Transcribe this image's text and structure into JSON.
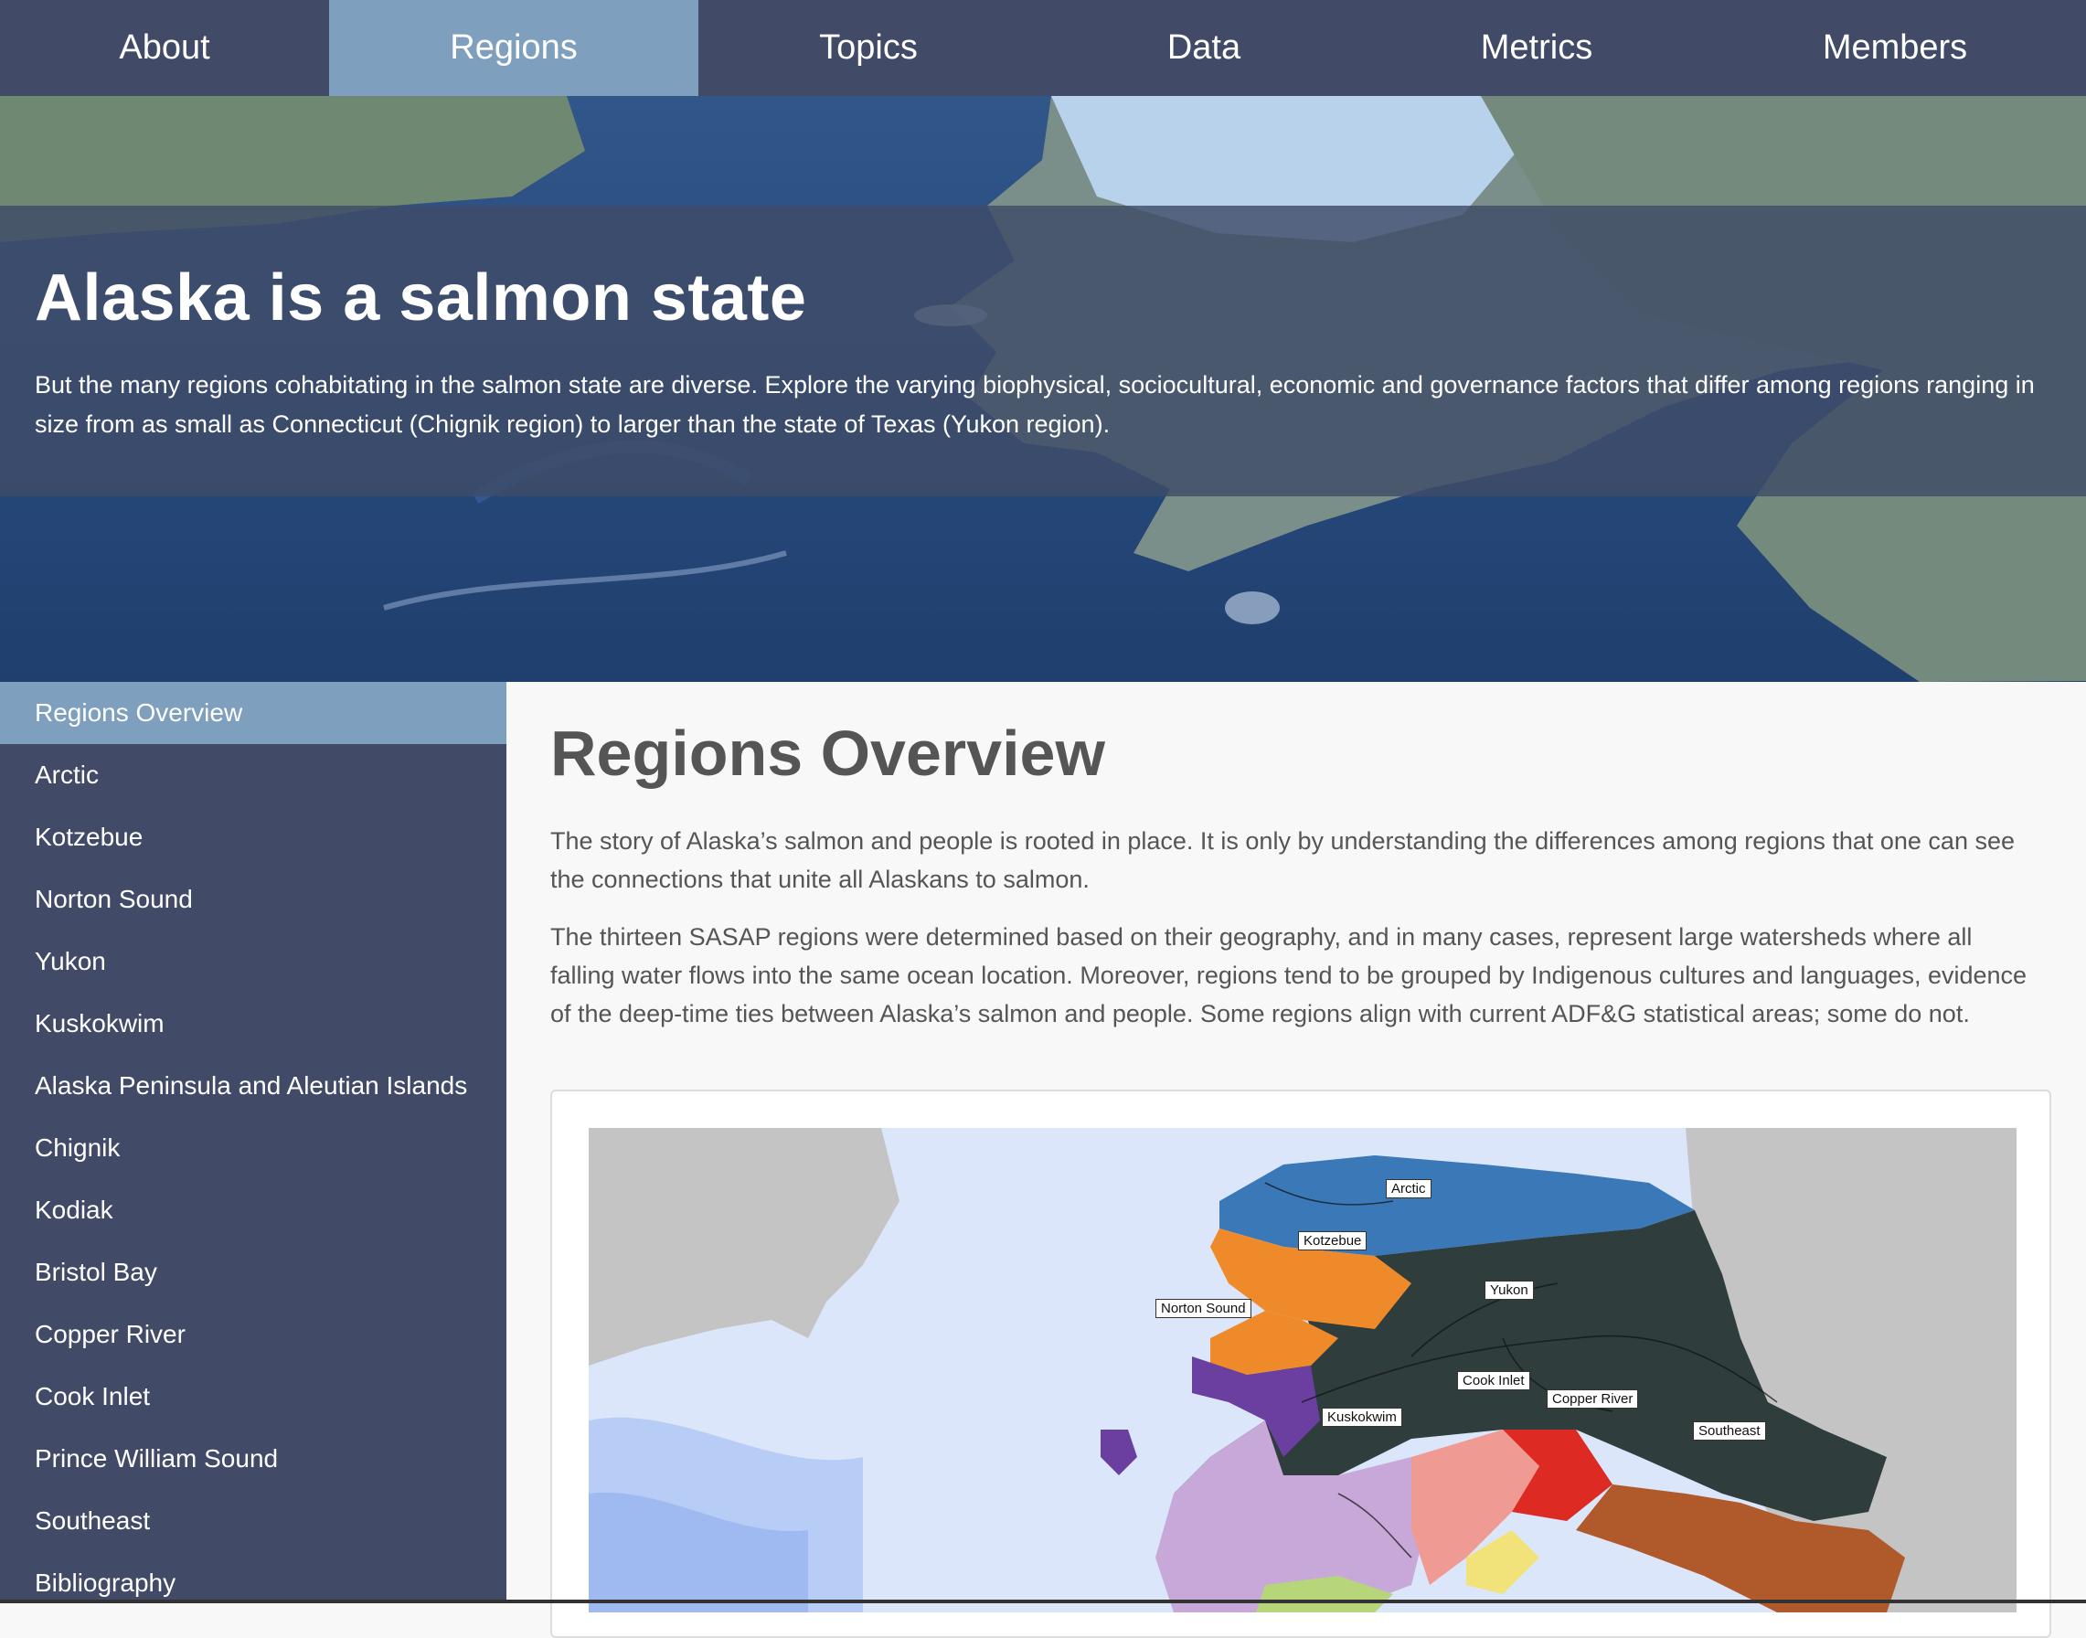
{
  "nav": {
    "tabs": [
      {
        "label": "About"
      },
      {
        "label": "Regions"
      },
      {
        "label": "Topics"
      },
      {
        "label": "Data"
      },
      {
        "label": "Metrics"
      },
      {
        "label": "Members"
      }
    ],
    "active_index": 1
  },
  "hero": {
    "title": "Alaska is a salmon state",
    "text": "But the many regions cohabitating in the salmon state are diverse. Explore the varying biophysical, sociocultural, economic and governance factors that differ among regions ranging in size from as small as Connecticut (Chignik region) to larger than the state of Texas (Yukon region)."
  },
  "sidebar": {
    "items": [
      {
        "label": "Regions Overview"
      },
      {
        "label": "Arctic"
      },
      {
        "label": "Kotzebue"
      },
      {
        "label": "Norton Sound"
      },
      {
        "label": "Yukon"
      },
      {
        "label": "Kuskokwim"
      },
      {
        "label": "Alaska Peninsula and Aleutian Islands"
      },
      {
        "label": "Chignik"
      },
      {
        "label": "Kodiak"
      },
      {
        "label": "Bristol Bay"
      },
      {
        "label": "Copper River"
      },
      {
        "label": "Cook Inlet"
      },
      {
        "label": "Prince William Sound"
      },
      {
        "label": "Southeast"
      },
      {
        "label": "Bibliography"
      }
    ],
    "active_index": 0
  },
  "main": {
    "title": "Regions Overview",
    "paragraphs": [
      "The story of Alaska’s salmon and people is rooted in place. It is only by understanding the differences among regions that one can see the connections that unite all Alaskans to salmon.",
      "The thirteen SASAP regions were determined based on their geography, and in many cases, represent large watersheds where all falling water flows into the same ocean location. Moreover, regions tend to be grouped by Indigenous cultures and languages, evidence of the deep-time ties between Alaska’s salmon and people. Some regions align with current ADF&G statistical areas; some do not."
    ],
    "map_labels": {
      "arctic": "Arctic",
      "kotzebue": "Kotzebue",
      "yukon": "Yukon",
      "norton": "Norton Sound",
      "cook": "Cook Inlet",
      "copper": "Copper River",
      "kuskokwim": "Kuskokwim",
      "southeast": "Southeast"
    }
  },
  "colors": {
    "nav_bg": "#414a66",
    "nav_active": "#7f9fbf",
    "arctic": "#3b78b8",
    "kotzebue": "#ee8a2a",
    "norton": "#6a3fa0",
    "yukon": "#2f3d3d",
    "kuskokwim": "#c7a8d8",
    "cook": "#f09a94",
    "copper": "#dd2a22",
    "southeast": "#b0592a"
  }
}
